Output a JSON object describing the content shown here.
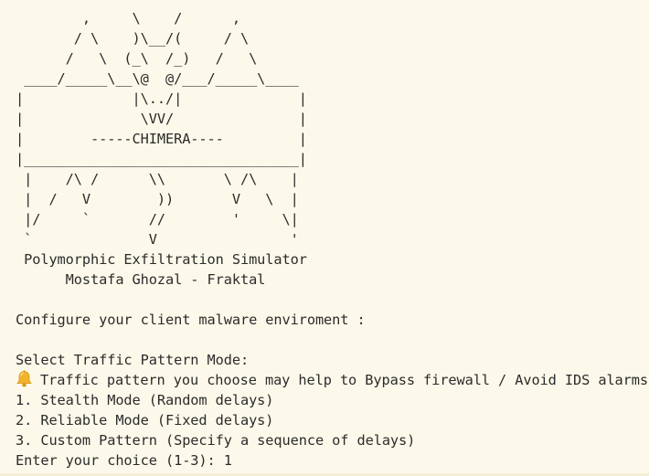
{
  "banner": {
    "ascii_art": "        ,     \\    /      ,\n       / \\    )\\__/(     / \\\n      /   \\  (_\\  /_)   /   \\\n ____/_____\\__\\@  @/___/_____\\____\n|             |\\../|              |\n|              \\VV/               |\n|        -----CHIMERA----         |\n|_________________________________|\n |    /\\ /      \\\\       \\ /\\    |\n |  /   V        ))       V   \\  |\n |/     `       //        '     \\|\n `              V                '",
    "title": " Polymorphic Exfiltration Simulator",
    "author": "      Mostafa Ghozal - Fraktal"
  },
  "prompt": {
    "configure": "Configure your client malware enviroment :",
    "select_mode": "Select Traffic Pattern Mode:",
    "notice_icon": "bell-icon",
    "notice_text": "Traffic pattern you choose may help to Bypass firewall / Avoid IDS alarms",
    "options": [
      "1. Stealth Mode (Random delays)",
      "2. Reliable Mode (Fixed delays)",
      "3. Custom Pattern (Specify a sequence of delays)"
    ],
    "input_label": "Enter your choice (1-3): ",
    "input_value": "1"
  },
  "colors": {
    "background": "#fdf9ea",
    "text": "#2b2b2b",
    "bell": "#f2b32c"
  }
}
